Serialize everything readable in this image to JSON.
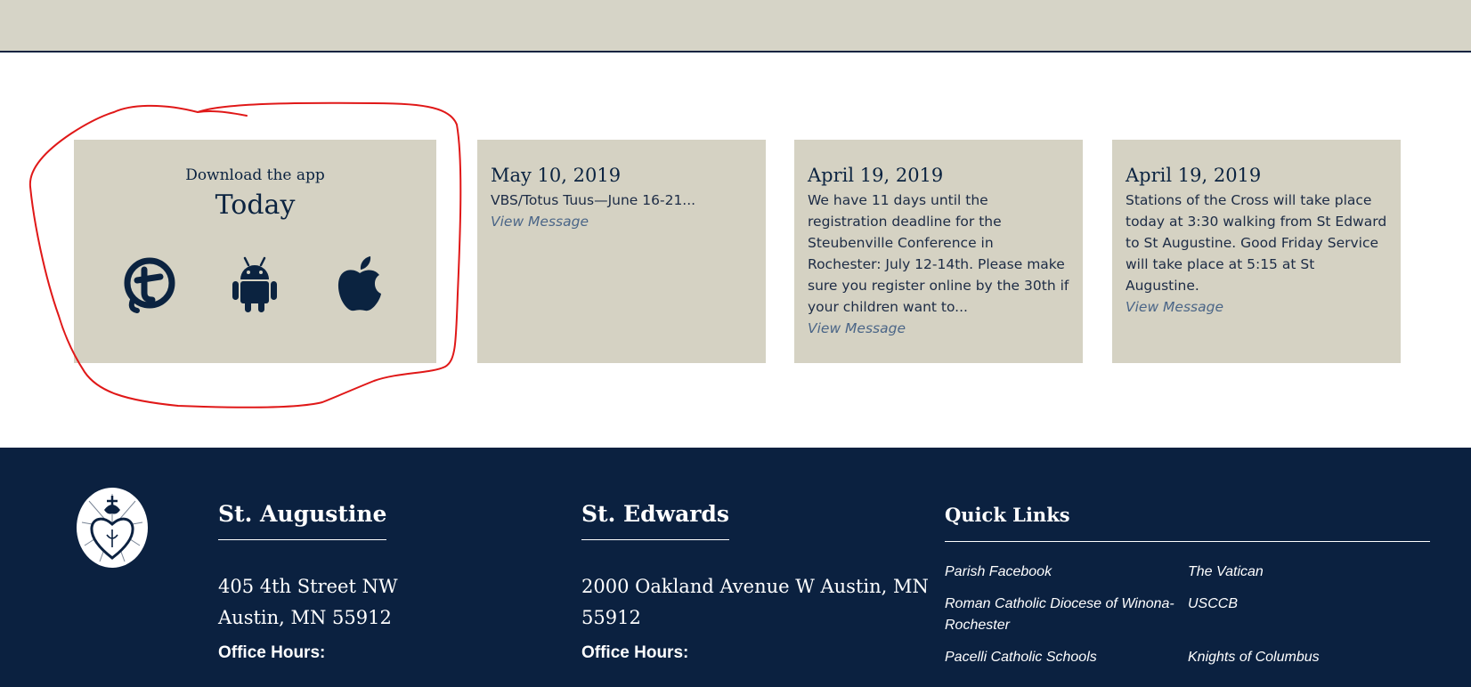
{
  "app_promo": {
    "title": "Download the app",
    "subtitle": "Today",
    "icons": [
      "formed-app-icon",
      "android-icon",
      "apple-icon"
    ]
  },
  "messages": [
    {
      "date": "May 10, 2019",
      "text": "VBS/Totus Tuus—June 16-21...",
      "link": "View Message"
    },
    {
      "date": "April 19, 2019",
      "text": "We have 11 days until the registration deadline for the Steubenville Conference in Rochester: July 12-14th. Please make sure you register online by the 30th if your children want to...",
      "link": "View Message"
    },
    {
      "date": "April 19, 2019",
      "text": "Stations of the Cross will take place today at 3:30 walking from St Edward to St Augustine. Good Friday Service will take place at 5:15 at St Augustine.",
      "link": "View Message"
    }
  ],
  "footer": {
    "augustine": {
      "title": "St. Augustine",
      "address_line1": "405 4th Street NW",
      "address_line2": "Austin, MN 55912",
      "hours_label": "Office Hours:"
    },
    "edwards": {
      "title": "St. Edwards",
      "address_line1": "2000 Oakland Avenue W Austin, MN",
      "address_line2": "55912",
      "hours_label": "Office Hours:"
    },
    "quick_links": {
      "title": "Quick Links",
      "links": [
        "Parish Facebook",
        "The Vatican",
        "Roman Catholic Diocese of Winona-",
        "Rochester",
        "USCCB",
        "Pacelli Catholic Schools",
        "Knights of Columbus"
      ]
    }
  },
  "colors": {
    "navy": "#0b2140",
    "card_beige": "#d5d2c3",
    "band_beige": "#d6d4c7",
    "link_blue": "#4a6587",
    "annotation_red": "#e01818"
  }
}
